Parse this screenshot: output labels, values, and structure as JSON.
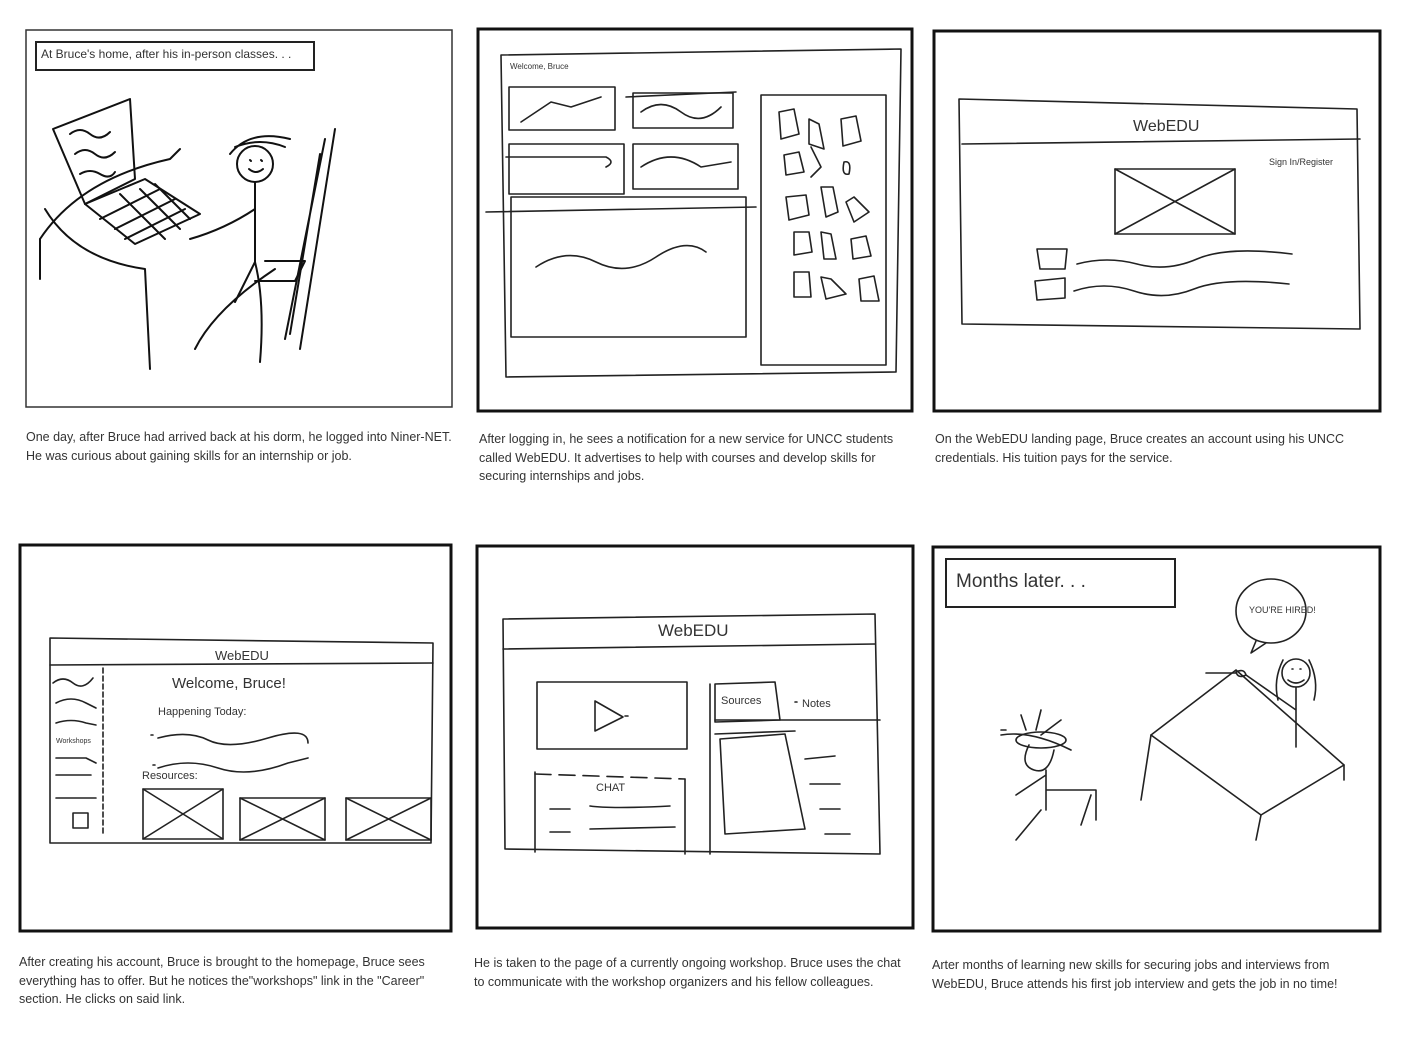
{
  "panels": [
    {
      "box_text": "At Bruce's home, after his in-person classes. . .",
      "caption": "One day, after Bruce had arrived back at his dorm, he logged into Niner-NET. He was curious about gaining skills for an internship or job."
    },
    {
      "welcome": "Welcome, Bruce",
      "caption": "After logging in, he sees a notification for a new service for UNCC students called WebEDU. It advertises to help with courses and develop skills for securing internships and jobs."
    },
    {
      "title": "WebEDU",
      "signin": "Sign In/Register",
      "caption": "On the WebEDU landing page, Bruce creates an account using his UNCC credentials. His tuition pays for the service."
    },
    {
      "title": "WebEDU",
      "welcome": "Welcome, Bruce!",
      "happening": "Happening Today:",
      "workshops": "Workshops",
      "resources": "Resources:",
      "caption": "After creating his account, Bruce is brought to the homepage, Bruce sees everything has to offer. But he notices the\"workshops\" link in the \"Career\" section. He clicks on said link."
    },
    {
      "title": "WebEDU",
      "sources": "Sources",
      "notes": "Notes",
      "chat": "CHAT",
      "caption": "He is taken to the page of a currently ongoing workshop. Bruce uses the chat to communicate with the workshop organizers and his fellow colleagues."
    },
    {
      "box_text": "Months later. . .",
      "bubble": "YOU'RE HIRED!",
      "caption": "Arter months of learning new skills for securing jobs and interviews from WebEDU, Bruce attends his first job interview and gets the job in no time!"
    }
  ]
}
